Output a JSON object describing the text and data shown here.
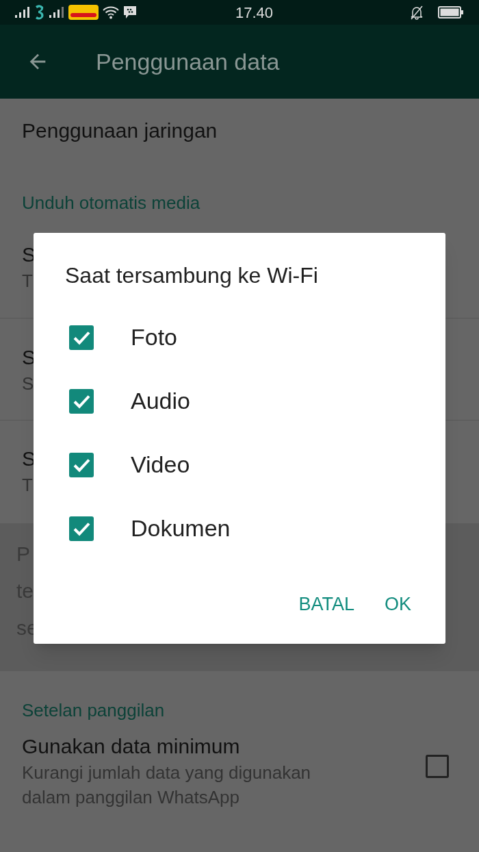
{
  "status_bar": {
    "time": "17.40"
  },
  "app_bar": {
    "title": "Penggunaan data"
  },
  "settings": [
    {
      "kind": "item",
      "title": "Penggunaan jaringan"
    },
    {
      "kind": "section",
      "title": "Unduh otomatis media"
    },
    {
      "kind": "item",
      "title": "S",
      "subtitle": "T"
    },
    {
      "kind": "item",
      "title": "S",
      "subtitle": "S"
    },
    {
      "kind": "item",
      "title": "S",
      "subtitle": "T"
    },
    {
      "kind": "note",
      "lines": [
        "P",
        "te",
        "se"
      ]
    },
    {
      "kind": "section",
      "title": "Setelan panggilan"
    },
    {
      "kind": "checkbox",
      "title": "Gunakan data minimum",
      "subtitle": "Kurangi jumlah data yang digunakan dalam panggilan WhatsApp",
      "checked": false
    }
  ],
  "dialog": {
    "title": "Saat tersambung ke Wi-Fi",
    "options": [
      {
        "label": "Foto",
        "checked": true
      },
      {
        "label": "Audio",
        "checked": true
      },
      {
        "label": "Video",
        "checked": true
      },
      {
        "label": "Dokumen",
        "checked": true
      }
    ],
    "buttons": [
      "BATAL",
      "OK"
    ]
  }
}
